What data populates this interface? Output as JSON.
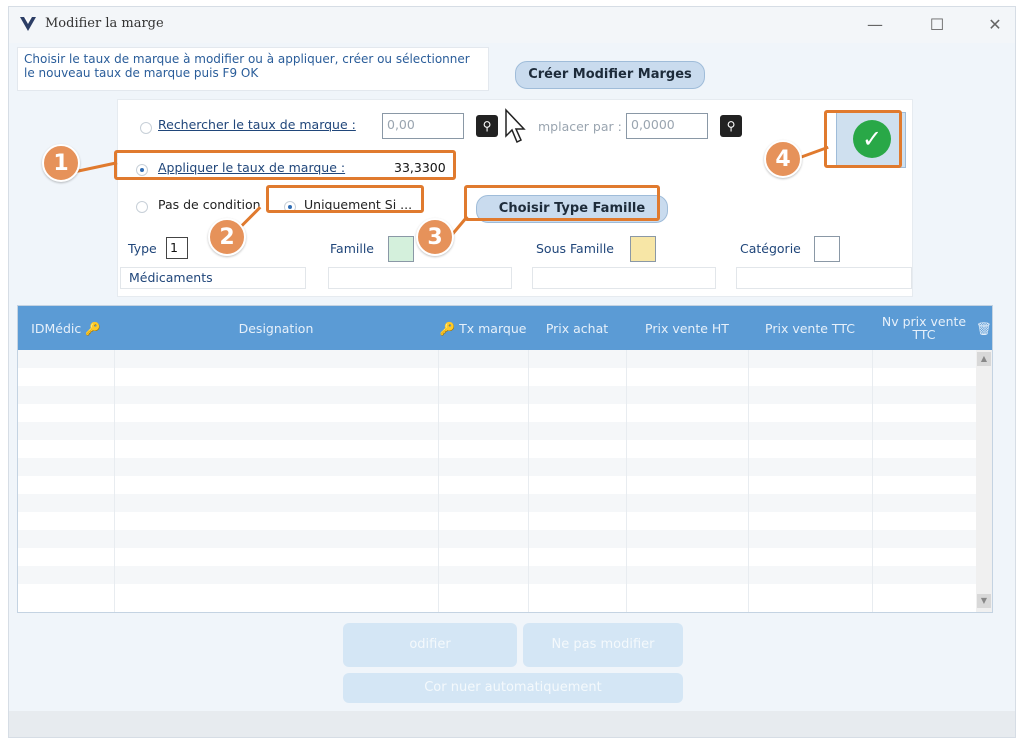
{
  "window": {
    "title": "Modifier la marge",
    "minimize_glyph": "—",
    "maximize_glyph": "☐",
    "close_glyph": "✕"
  },
  "instructions": "Choisir le taux de marque à modifier ou à appliquer, créer ou sélectionner le nouveau taux de marque puis F9 OK",
  "create_button": "Créer Modifier Marges",
  "search": {
    "label": "Rechercher le taux de marque :",
    "value": "0,00",
    "replace_label": "mplacer par :",
    "replace_value": "0,0000"
  },
  "apply": {
    "label": "Appliquer le taux de marque :",
    "value": "33,3300"
  },
  "conditions": {
    "none_label": "Pas de condition",
    "only_if_label": "Uniquement Si ..."
  },
  "choose_type_button": "Choisir Type Famille",
  "filters": {
    "type_label": "Type",
    "type_value": "1",
    "type_name": "Médicaments",
    "famille_label": "Famille",
    "sous_famille_label": "Sous Famille",
    "categorie_label": "Catégorie"
  },
  "annotations": [
    "1",
    "2",
    "3",
    "4"
  ],
  "table": {
    "columns": [
      "IDMédic",
      "Designation",
      "Tx marque",
      "Prix achat",
      "Prix vente HT",
      "Prix vente TTC",
      "Nv prix vente TTC"
    ]
  },
  "buttons": {
    "modifier": "odifier",
    "ne_pas_modifier": "Ne pas modifier",
    "auto": "Cor  nuer automatiquement"
  },
  "colors": {
    "accent_orange": "#e07a2e",
    "header_blue": "#5b9bd5",
    "ok_green": "#29a847",
    "famille_swatch": "#d4f0dc",
    "sous_famille_swatch": "#f7e6a6"
  }
}
